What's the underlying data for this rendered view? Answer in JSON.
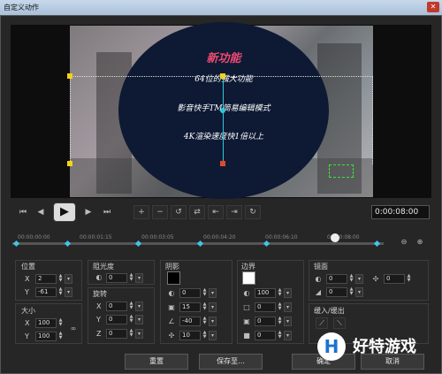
{
  "window": {
    "title": "自定义动作",
    "close_icon": "close-icon"
  },
  "video": {
    "title": "新功能",
    "lines": [
      "64位的强大功能",
      "影音快手TM简易编辑模式",
      "4K渲染速度快1倍以上"
    ]
  },
  "playback": {
    "timecode": "0:00:08:00",
    "icons": [
      "skip-start-icon",
      "step-back-icon",
      "play-icon",
      "step-forward-icon",
      "skip-end-icon"
    ]
  },
  "timeline": {
    "ticks": [
      "00:00:00:00",
      "00:00:01:15",
      "00:00:03:05",
      "00:00:04:20",
      "00:00:06:10",
      "00:00:08:00"
    ],
    "playhead": 0.87
  },
  "panels": {
    "position": {
      "label": "位置",
      "x_label": "X",
      "x": "2",
      "y_label": "Y",
      "y": "-61"
    },
    "size": {
      "label": "大小",
      "x_label": "X",
      "x": "100",
      "y_label": "Y",
      "y": "100"
    },
    "opacity": {
      "label": "阻光度",
      "value": "0"
    },
    "rotation": {
      "label": "旋转",
      "x_label": "X",
      "x": "0",
      "y_label": "Y",
      "y": "0",
      "z_label": "Z",
      "z": "0"
    },
    "shadow": {
      "label": "阴影",
      "v1": "0",
      "v2": "15",
      "v3": "-40",
      "v4": "10"
    },
    "border": {
      "label": "边界",
      "v1": "100",
      "v2": "0",
      "v3": "0",
      "v4": "0"
    },
    "mirror": {
      "label": "镜面",
      "v1": "0",
      "v2": "0",
      "v3": "0"
    },
    "fade": {
      "label": "缓入/缓出"
    }
  },
  "buttons": {
    "reset": "重置",
    "save": "保存至...",
    "ok": "确定",
    "cancel": "取消"
  },
  "watermark": {
    "text": "好特游戏"
  },
  "colors": {
    "accent": "#3fc6e8",
    "title_pink": "#f04a72",
    "circle": "#0e1a34"
  }
}
